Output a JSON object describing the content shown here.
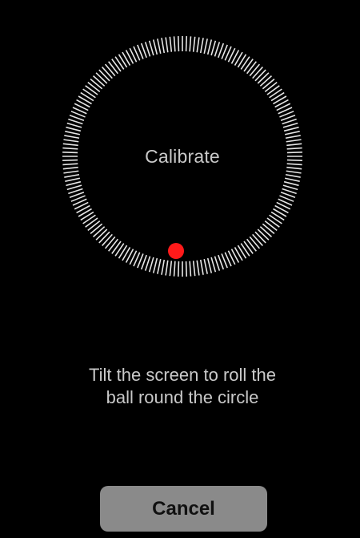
{
  "dial": {
    "label": "Calibrate"
  },
  "instruction": "Tilt the screen to roll the\nball round the circle",
  "cancel_label": "Cancel",
  "colors": {
    "background": "#000000",
    "ticks": "#e6e6e6",
    "text": "#c9c9c9",
    "ball": "#ff1a1a",
    "button": "#8a8a8a"
  }
}
